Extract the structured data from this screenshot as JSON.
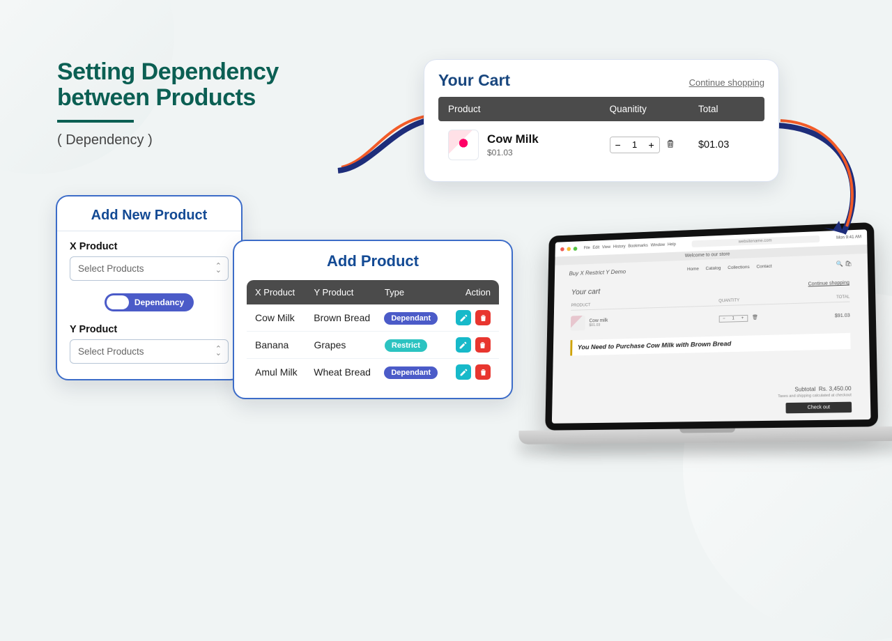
{
  "hero": {
    "title_l1": "Setting Dependency",
    "title_l2": "between Products",
    "subtitle": "( Dependency )"
  },
  "add_new": {
    "title": "Add New Product",
    "x_label": "X Product",
    "x_placeholder": "Select Products",
    "toggle_label": "Dependancy",
    "y_label": "Y Product",
    "y_placeholder": "Select Products"
  },
  "add_product": {
    "title": "Add Product",
    "headers": {
      "x": "X Product",
      "y": "Y Product",
      "type": "Type",
      "action": "Action"
    },
    "rows": [
      {
        "x": "Cow Milk",
        "y": "Brown Bread",
        "type": "Dependant",
        "type_kind": "dep"
      },
      {
        "x": "Banana",
        "y": "Grapes",
        "type": "Restrict",
        "type_kind": "res"
      },
      {
        "x": "Amul Milk",
        "y": "Wheat Bread",
        "type": "Dependant",
        "type_kind": "dep"
      }
    ]
  },
  "cart": {
    "title": "Your Cart",
    "continue": "Continue shopping",
    "headers": {
      "product": "Product",
      "quantity": "Quanitity",
      "total": "Total"
    },
    "item": {
      "name": "Cow Milk",
      "price": "$01.03",
      "qty": "1",
      "total": "$01.03"
    }
  },
  "browser": {
    "menus": [
      "File",
      "Edit",
      "View",
      "History",
      "Bookmarks",
      "Window",
      "Help"
    ],
    "clock": "Mon 9:41 AM",
    "url": "websitename.com",
    "banner": "Welcome to our store"
  },
  "shop": {
    "brand": "Buy X Restrict Y Demo",
    "menu": [
      "Home",
      "Catalog",
      "Collections",
      "Contact"
    ],
    "cart_title": "Your cart",
    "continue": "Continue shopping",
    "headers": {
      "product": "PRODUCT",
      "quantity": "QUANTITY",
      "total": "TOTAL"
    },
    "item": {
      "name": "Cow milk",
      "price": "$01.03",
      "qty": "1",
      "total": "$91.03"
    },
    "alert": "You Need to Purchase Cow Milk with Brown Bread",
    "subtotal_label": "Subtotal",
    "subtotal_value": "Rs. 3,450.00",
    "note": "Taxes and shipping calculated at checkout",
    "checkout": "Check out"
  }
}
